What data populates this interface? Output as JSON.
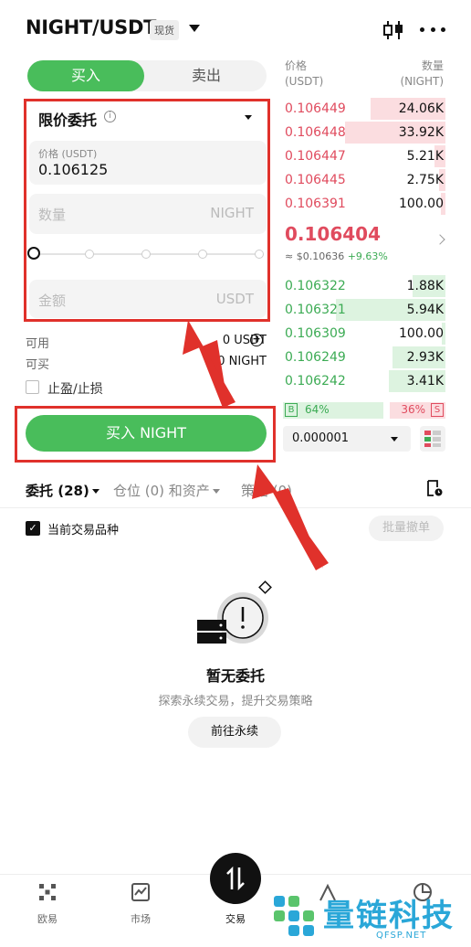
{
  "header": {
    "pair": "NIGHT/USDT",
    "market_badge": "现货"
  },
  "form": {
    "tabs": {
      "buy": "买入",
      "sell": "卖出"
    },
    "order_type": "限价委托",
    "price_label": "价格 (USDT)",
    "price_value": "0.106125",
    "qty_placeholder": "数量",
    "qty_unit": "NIGHT",
    "amount_placeholder": "金额",
    "amount_unit": "USDT",
    "slider_level": 0,
    "available_label": "可用",
    "available_value": "0 USDT",
    "can_buy_label": "可买",
    "can_buy_value": "0 NIGHT",
    "tpsl_label": "止盈/止损",
    "submit_label": "买入 NIGHT",
    "buy_color": "#49bd5b"
  },
  "orderbook": {
    "price_header": [
      "价格",
      "(USDT)"
    ],
    "qty_header": [
      "数量",
      "(NIGHT)"
    ],
    "asks": [
      {
        "price": "0.106449",
        "qty": "24.06K",
        "depth": 0.68
      },
      {
        "price": "0.106448",
        "qty": "33.92K",
        "depth": 0.92
      },
      {
        "price": "0.106447",
        "qty": "5.21K",
        "depth": 0.1
      },
      {
        "price": "0.106445",
        "qty": "2.75K",
        "depth": 0.06
      },
      {
        "price": "0.106391",
        "qty": "100.00",
        "depth": 0.04
      }
    ],
    "last_price": "0.106404",
    "last_fiat": "≈ $0.10636",
    "last_change": "+9.63%",
    "bids": [
      {
        "price": "0.106322",
        "qty": "1.88K",
        "depth": 0.3
      },
      {
        "price": "0.106321",
        "qty": "5.94K",
        "depth": 1.0
      },
      {
        "price": "0.106309",
        "qty": "100.00",
        "depth": 0.03
      },
      {
        "price": "0.106249",
        "qty": "2.93K",
        "depth": 0.48
      },
      {
        "price": "0.106242",
        "qty": "3.41K",
        "depth": 0.52
      }
    ],
    "buy_tag": "B",
    "buy_pct": "64%",
    "sell_pct": "36%",
    "sell_tag": "S",
    "buy_ratio": 0.64,
    "precision": "0.000001",
    "ask_color": "#e04b5e",
    "bid_color": "#3cab54"
  },
  "list_tabs": {
    "orders": "委托 (28)",
    "positions": "仓位 (0) 和资产",
    "strategies": "策略 (0)"
  },
  "filter": {
    "current_only": "当前交易品种",
    "batch_cancel": "批量撤单"
  },
  "empty": {
    "title": "暂无委托",
    "subtitle": "探索永续交易，提升交易策略",
    "button": "前往永续"
  },
  "nav": {
    "home": "欧易",
    "market": "市场",
    "trade": "交易"
  },
  "watermark": {
    "text": "量链科技",
    "sub": "QFSP.NET"
  }
}
